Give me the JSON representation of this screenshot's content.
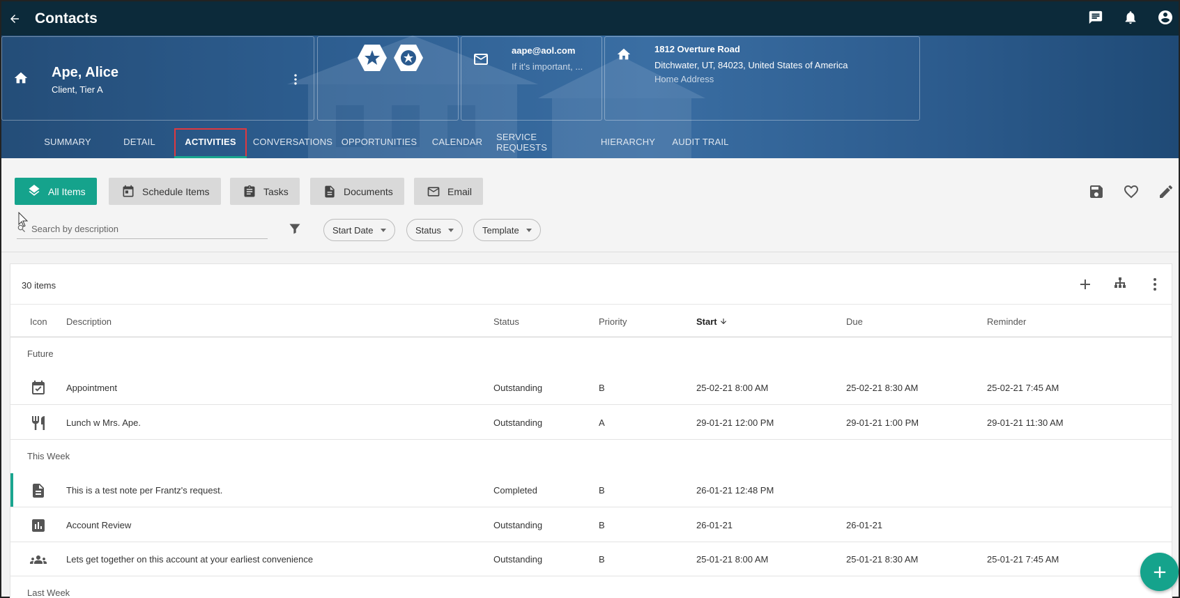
{
  "appbar": {
    "title": "Contacts"
  },
  "contact": {
    "name": "Ape, Alice",
    "subtitle": "Client, Tier A",
    "email": "aape@aol.com",
    "email_note": "If it's important, ...",
    "address_line1": "1812 Overture Road",
    "address_line2": "Ditchwater, UT, 84023, United States of America",
    "address_type": "Home Address"
  },
  "tabs": [
    {
      "label": "SUMMARY"
    },
    {
      "label": "DETAIL"
    },
    {
      "label": "ACTIVITIES"
    },
    {
      "label": "CONVERSATIONS"
    },
    {
      "label": "OPPORTUNITIES"
    },
    {
      "label": "CALENDAR"
    },
    {
      "label": "SERVICE REQUESTS"
    },
    {
      "label": "HIERARCHY"
    },
    {
      "label": "AUDIT TRAIL"
    }
  ],
  "filters": {
    "all_items": "All Items",
    "schedule_items": "Schedule Items",
    "tasks": "Tasks",
    "documents": "Documents",
    "email": "Email",
    "search_placeholder": "Search by description",
    "chips": [
      "Start Date",
      "Status",
      "Template"
    ]
  },
  "list": {
    "count": "30 items",
    "columns": {
      "icon": "Icon",
      "description": "Description",
      "status": "Status",
      "priority": "Priority",
      "start": "Start",
      "due": "Due",
      "reminder": "Reminder"
    },
    "groups": [
      "Future",
      "This Week",
      "Last Week"
    ],
    "rows": [
      {
        "icon": "calendar-check-icon",
        "description": "Appointment",
        "status": "Outstanding",
        "priority": "B",
        "start": "25-02-21 8:00 AM",
        "due": "25-02-21 8:30 AM",
        "reminder": "25-02-21 7:45 AM"
      },
      {
        "icon": "restaurant-icon",
        "description": "Lunch w Mrs. Ape.",
        "status": "Outstanding",
        "priority": "A",
        "start": "29-01-21 12:00 PM",
        "due": "29-01-21 1:00 PM",
        "reminder": "29-01-21 11:30 AM"
      },
      {
        "icon": "note-icon",
        "description": "This is a test note per Frantz's request.",
        "status": "Completed",
        "priority": "B",
        "start": "26-01-21 12:48 PM",
        "due": "",
        "reminder": ""
      },
      {
        "icon": "chart-icon",
        "description": "Account Review",
        "status": "Outstanding",
        "priority": "B",
        "start": "26-01-21",
        "due": "26-01-21",
        "reminder": ""
      },
      {
        "icon": "group-icon",
        "description": "Lets get together on this account at your earliest convenience",
        "status": "Outstanding",
        "priority": "B",
        "start": "25-01-21 8:00 AM",
        "due": "25-01-21 8:30 AM",
        "reminder": "25-01-21 7:45 AM"
      }
    ]
  },
  "colors": {
    "appbar": "#0c2a3a",
    "accent": "#15a38c",
    "highlight": "#e0383e"
  }
}
